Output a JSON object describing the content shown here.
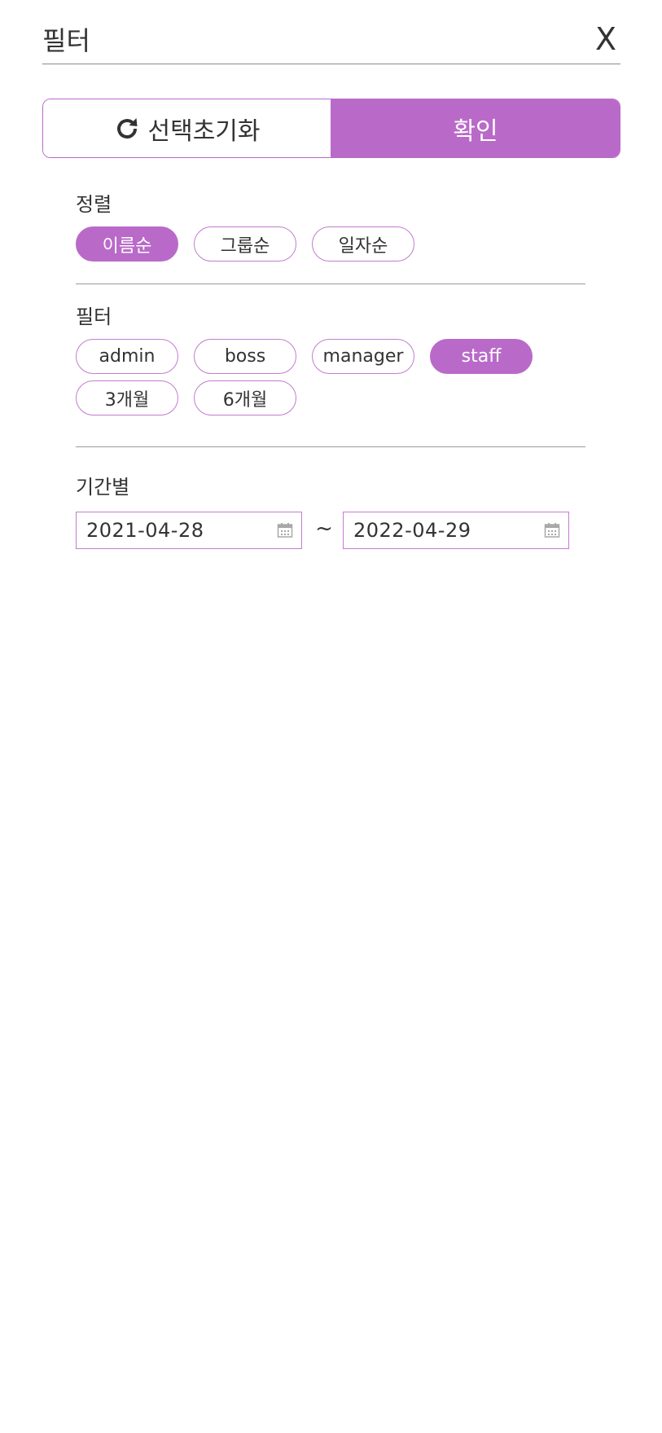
{
  "header": {
    "title": "필터",
    "close_label": "X"
  },
  "actions": {
    "reset_label": "선택초기화",
    "reset_icon": "refresh-icon",
    "confirm_label": "확인"
  },
  "sort": {
    "label": "정렬",
    "options": [
      {
        "label": "이름순",
        "selected": true
      },
      {
        "label": "그룹순",
        "selected": false
      },
      {
        "label": "일자순",
        "selected": false
      }
    ]
  },
  "filter": {
    "label": "필터",
    "options": [
      {
        "label": "admin",
        "selected": false
      },
      {
        "label": "boss",
        "selected": false
      },
      {
        "label": "manager",
        "selected": false
      },
      {
        "label": "staff",
        "selected": true
      },
      {
        "label": "3개월",
        "selected": false
      },
      {
        "label": "6개월",
        "selected": false
      }
    ]
  },
  "period": {
    "label": "기간별",
    "start_date": "2021-04-28",
    "separator": "~",
    "end_date": "2022-04-29",
    "icon": "calendar-icon"
  },
  "colors": {
    "accent": "#b96ac9",
    "text": "#333333",
    "divider": "#9b9b9b"
  }
}
